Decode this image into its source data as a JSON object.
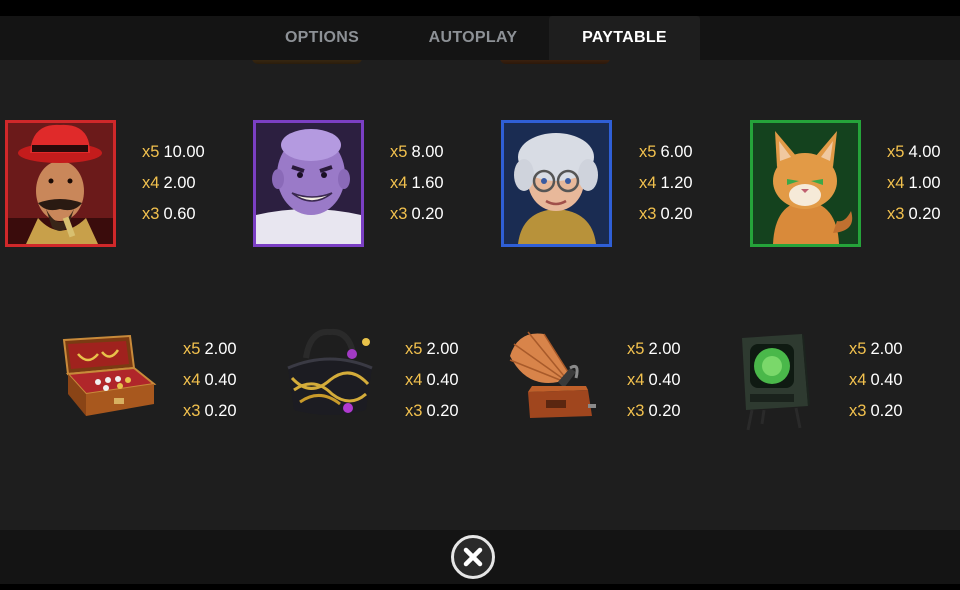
{
  "tabs": {
    "options": "OPTIONS",
    "autoplay": "AUTOPLAY",
    "paytable": "PAYTABLE",
    "active": "paytable"
  },
  "symbols_row1": [
    {
      "name": "detective",
      "frame_color": "#d0282a",
      "pays": [
        {
          "mult": "x5",
          "amount": "10.00"
        },
        {
          "mult": "x4",
          "amount": "2.00"
        },
        {
          "mult": "x3",
          "amount": "0.60"
        }
      ]
    },
    {
      "name": "thug",
      "frame_color": "#7b3fc4",
      "pays": [
        {
          "mult": "x5",
          "amount": "8.00"
        },
        {
          "mult": "x4",
          "amount": "1.60"
        },
        {
          "mult": "x3",
          "amount": "0.20"
        }
      ]
    },
    {
      "name": "granny",
      "frame_color": "#2f5fd6",
      "pays": [
        {
          "mult": "x5",
          "amount": "6.00"
        },
        {
          "mult": "x4",
          "amount": "1.20"
        },
        {
          "mult": "x3",
          "amount": "0.20"
        }
      ]
    },
    {
      "name": "cat",
      "frame_color": "#25a33a",
      "pays": [
        {
          "mult": "x5",
          "amount": "4.00"
        },
        {
          "mult": "x4",
          "amount": "1.00"
        },
        {
          "mult": "x3",
          "amount": "0.20"
        }
      ]
    }
  ],
  "symbols_row2": [
    {
      "name": "jewelry-box",
      "pays": [
        {
          "mult": "x5",
          "amount": "2.00"
        },
        {
          "mult": "x4",
          "amount": "0.40"
        },
        {
          "mult": "x3",
          "amount": "0.20"
        }
      ]
    },
    {
      "name": "handbag",
      "pays": [
        {
          "mult": "x5",
          "amount": "2.00"
        },
        {
          "mult": "x4",
          "amount": "0.40"
        },
        {
          "mult": "x3",
          "amount": "0.20"
        }
      ]
    },
    {
      "name": "gramophone",
      "pays": [
        {
          "mult": "x5",
          "amount": "2.00"
        },
        {
          "mult": "x4",
          "amount": "0.40"
        },
        {
          "mult": "x3",
          "amount": "0.20"
        }
      ]
    },
    {
      "name": "television",
      "pays": [
        {
          "mult": "x5",
          "amount": "2.00"
        },
        {
          "mult": "x4",
          "amount": "0.40"
        },
        {
          "mult": "x3",
          "amount": "0.20"
        }
      ]
    }
  ],
  "colors": {
    "multiplier": "#f2c14e",
    "amount": "#ffffff",
    "tab_inactive": "#8d9196",
    "tab_active": "#ffffff",
    "panel_bg": "#1e1e1e",
    "bar_bg": "#141414"
  },
  "close_icon": "close-icon"
}
